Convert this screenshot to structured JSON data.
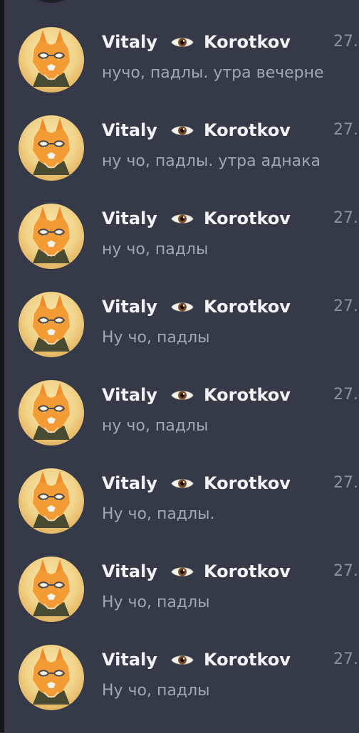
{
  "colors": {
    "background": "#363a48",
    "name": "#f1f3f7",
    "text": "#a3a7b5",
    "timestamp": "#8e92a0"
  },
  "messages": [
    {
      "author_first": "Vitaly",
      "author_badge_icon": "eye-icon",
      "author_last": "Korotkov",
      "timestamp": "27.",
      "text": "нучо, падлы. утра вечерне"
    },
    {
      "author_first": "Vitaly",
      "author_badge_icon": "eye-icon",
      "author_last": "Korotkov",
      "timestamp": "27.",
      "text": "ну чо, падлы. утра аднака"
    },
    {
      "author_first": "Vitaly",
      "author_badge_icon": "eye-icon",
      "author_last": "Korotkov",
      "timestamp": "27.",
      "text": "ну чо, падлы"
    },
    {
      "author_first": "Vitaly",
      "author_badge_icon": "eye-icon",
      "author_last": "Korotkov",
      "timestamp": "27.",
      "text": "Ну чо, падлы"
    },
    {
      "author_first": "Vitaly",
      "author_badge_icon": "eye-icon",
      "author_last": "Korotkov",
      "timestamp": "27.",
      "text": "ну чо, падлы"
    },
    {
      "author_first": "Vitaly",
      "author_badge_icon": "eye-icon",
      "author_last": "Korotkov",
      "timestamp": "27.",
      "text": "Ну чо, падлы."
    },
    {
      "author_first": "Vitaly",
      "author_badge_icon": "eye-icon",
      "author_last": "Korotkov",
      "timestamp": "27.",
      "text": "Ну чо, падлы"
    },
    {
      "author_first": "Vitaly",
      "author_badge_icon": "eye-icon",
      "author_last": "Korotkov",
      "timestamp": "27.",
      "text": "Ну чо, падлы"
    }
  ]
}
